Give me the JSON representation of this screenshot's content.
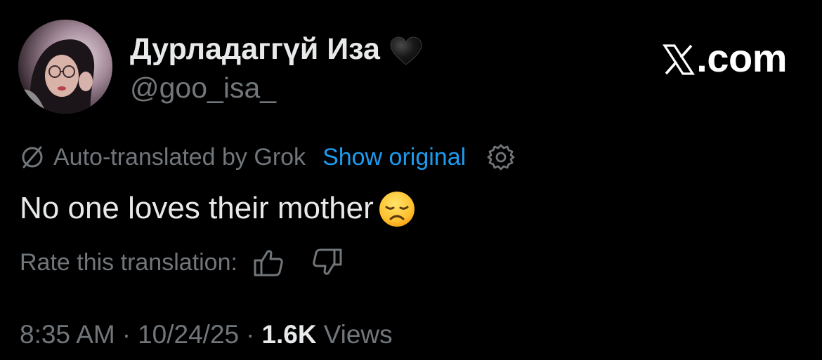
{
  "author": {
    "display_name": "Дурладаггүй Иза",
    "name_badge_icon": "black-heart-icon",
    "handle": "@goo_isa_"
  },
  "site": {
    "logo_icon": "x-logo-icon",
    "label": ".com"
  },
  "translation": {
    "icon": "translate-icon",
    "auto_label": "Auto-translated by Grok",
    "show_original_label": "Show original",
    "settings_icon": "gear-icon",
    "rate_label": "Rate this translation:",
    "thumbs_up_icon": "thumbs-up-icon",
    "thumbs_down_icon": "thumbs-down-icon"
  },
  "tweet": {
    "text": "No one loves their mother",
    "emoji_icon": "disappointed-face-icon"
  },
  "meta": {
    "time": "8:35 AM",
    "separator": "·",
    "date": "10/24/25",
    "views_count": "1.6K",
    "views_label": "Views"
  },
  "colors": {
    "background": "#000000",
    "text_primary": "#e7e9ea",
    "text_secondary": "#71767b",
    "link": "#1d9bf0"
  }
}
